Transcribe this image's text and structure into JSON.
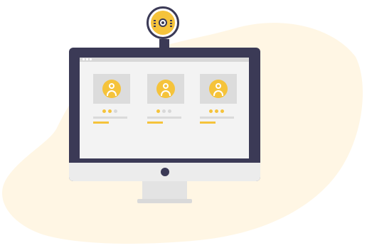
{
  "colors": {
    "accent": "#f5c33b",
    "dark": "#3b3a56",
    "background_blob": "#fff6e4"
  },
  "illustration": {
    "monitor_icon": "desktop-monitor-icon",
    "webcam_icon": "webcam-icon",
    "profiles": [
      {
        "icon": "user-avatar-icon",
        "rating": 2,
        "max_rating": 3
      },
      {
        "icon": "user-avatar-icon",
        "rating": 1,
        "max_rating": 3
      },
      {
        "icon": "user-avatar-icon",
        "rating": 3,
        "max_rating": 3
      }
    ]
  }
}
